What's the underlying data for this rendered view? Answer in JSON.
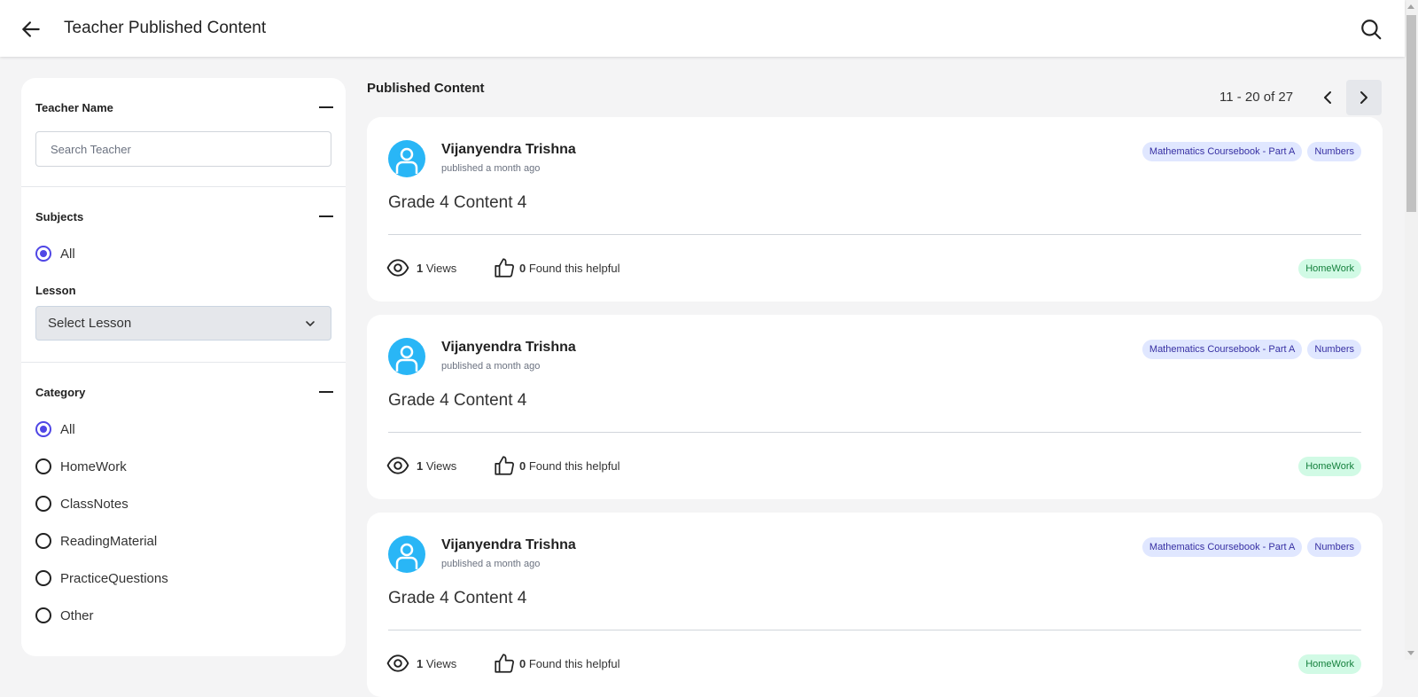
{
  "header": {
    "title": "Teacher Published Content",
    "back_icon": "arrow-left-icon",
    "search_icon": "search-icon"
  },
  "sidebar": {
    "teacher_section": {
      "title": "Teacher Name",
      "search_placeholder": "Search Teacher"
    },
    "subjects_section": {
      "title": "Subjects",
      "options": [
        {
          "label": "All",
          "checked": true
        }
      ],
      "lesson_label": "Lesson",
      "lesson_selected": "Select Lesson"
    },
    "category_section": {
      "title": "Category",
      "options": [
        {
          "label": "All",
          "checked": true
        },
        {
          "label": "HomeWork",
          "checked": false
        },
        {
          "label": "ClassNotes",
          "checked": false
        },
        {
          "label": "ReadingMaterial",
          "checked": false
        },
        {
          "label": "PracticeQuestions",
          "checked": false
        },
        {
          "label": "Other",
          "checked": false
        }
      ]
    }
  },
  "main": {
    "title": "Published Content",
    "pagination": {
      "range": "11 - 20 of 27"
    },
    "cards": [
      {
        "author": "Vijanyendra Trishna",
        "published": "published a month ago",
        "tags": [
          "Mathematics Coursebook - Part A",
          "Numbers"
        ],
        "title": "Grade 4 Content 4",
        "views_count": "1",
        "views_label": "Views",
        "helpful_count": "0",
        "helpful_label": "Found this helpful",
        "category": "HomeWork"
      },
      {
        "author": "Vijanyendra Trishna",
        "published": "published a month ago",
        "tags": [
          "Mathematics Coursebook - Part A",
          "Numbers"
        ],
        "title": "Grade 4 Content 4",
        "views_count": "1",
        "views_label": "Views",
        "helpful_count": "0",
        "helpful_label": "Found this helpful",
        "category": "HomeWork"
      },
      {
        "author": "Vijanyendra Trishna",
        "published": "published a month ago",
        "tags": [
          "Mathematics Coursebook - Part A",
          "Numbers"
        ],
        "title": "Grade 4 Content 4",
        "views_count": "1",
        "views_label": "Views",
        "helpful_count": "0",
        "helpful_label": "Found this helpful",
        "category": "HomeWork"
      }
    ]
  },
  "colors": {
    "accent": "#4f46e5",
    "avatar": "#29b6f6",
    "tag_bg": "#e0e7ff",
    "category_bg": "#d1fae5",
    "background": "#f4f4f5"
  }
}
